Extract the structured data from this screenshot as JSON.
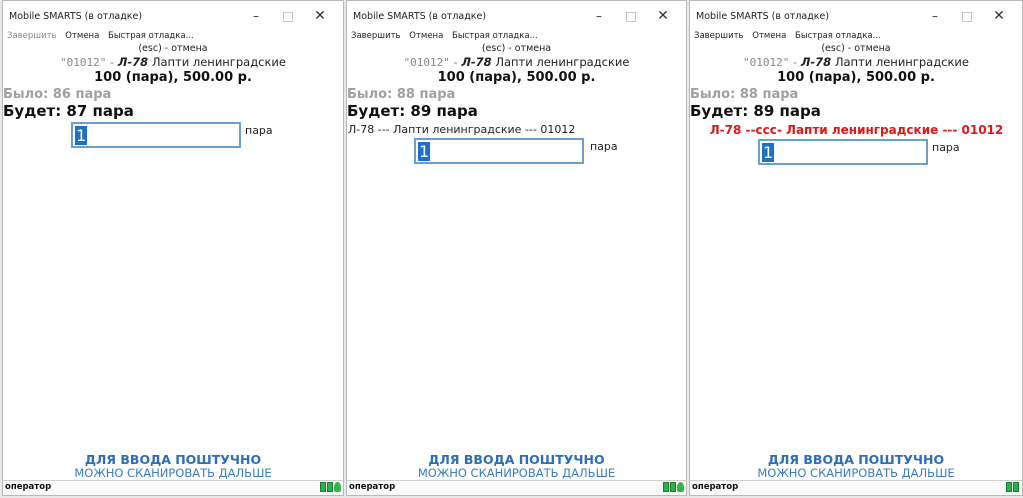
{
  "windows": [
    {
      "title": "Mobile SMARTS (в отладке)",
      "menu": [
        {
          "label": "Завершить",
          "disabled": true
        },
        {
          "label": "Отмена",
          "disabled": true
        },
        {
          "label": "Быстрая отладка...",
          "disabled": false
        }
      ],
      "esc": "(esc) - отмена",
      "code": "\"01012\"",
      "article": "Л-78",
      "product_name": "Лапти ленинградские",
      "price": "100 (пара), 500.00 р.",
      "was": "Было: 86 пара",
      "will": "Будет: 87 пара",
      "description": "",
      "qty": "1",
      "unit": "пара",
      "hint1": "ДЛЯ ВВОДА ПОШТУЧНО",
      "hint2": "МОЖНО СКАНИРОВАТЬ ДАЛЬШЕ",
      "status": "оператор"
    },
    {
      "title": "Mobile SMARTS (в отладке)",
      "menu": [
        {
          "label": "Завершить",
          "disabled": false
        },
        {
          "label": "Отмена",
          "disabled": false
        },
        {
          "label": "Быстрая отладка...",
          "disabled": false
        }
      ],
      "esc": "(esc) - отмена",
      "code": "\"01012\"",
      "article": "Л-78",
      "product_name": "Лапти ленинградские",
      "price": "100 (пара), 500.00 р.",
      "was": "Было: 88 пара",
      "will": "Будет: 89 пара",
      "description": "Л-78 --- Лапти ленинградские --- 01012",
      "qty": "1",
      "unit": "пара",
      "hint1": "ДЛЯ ВВОДА ПОШТУЧНО",
      "hint2": "МОЖНО СКАНИРОВАТЬ ДАЛЬШЕ",
      "status": "оператор"
    },
    {
      "title": "Mobile SMARTS (в отладке)",
      "menu": [
        {
          "label": "Завершить",
          "disabled": false
        },
        {
          "label": "Отмена",
          "disabled": false
        },
        {
          "label": "Быстрая отладка...",
          "disabled": false
        }
      ],
      "esc": "(esc) - отмена",
      "code": "\"01012\"",
      "article": "Л-78",
      "product_name": "Лапти ленинградские",
      "price": "100 (пара), 500.00 р.",
      "was": "Было: 88 пара",
      "will": "Будет: 89 пара",
      "description": "Л-78 --ссс- Лапти ленинградские --- 01012",
      "qty": "1",
      "unit": "пара",
      "hint1": "ДЛЯ ВВОДА ПОШТУЧНО",
      "hint2": "МОЖНО СКАНИРОВАТЬ ДАЛЬШЕ",
      "status": "оператор"
    }
  ],
  "colors": {
    "hint": "#2e6db8",
    "highlight_red": "#e01818",
    "selection": "#1e6fc8",
    "muted": "#a0a0a0"
  },
  "icons": {
    "minimize": "minimize-icon",
    "maximize": "maximize-icon",
    "close": "close-icon",
    "battery": "battery-icon",
    "signal": "signal-icon"
  }
}
